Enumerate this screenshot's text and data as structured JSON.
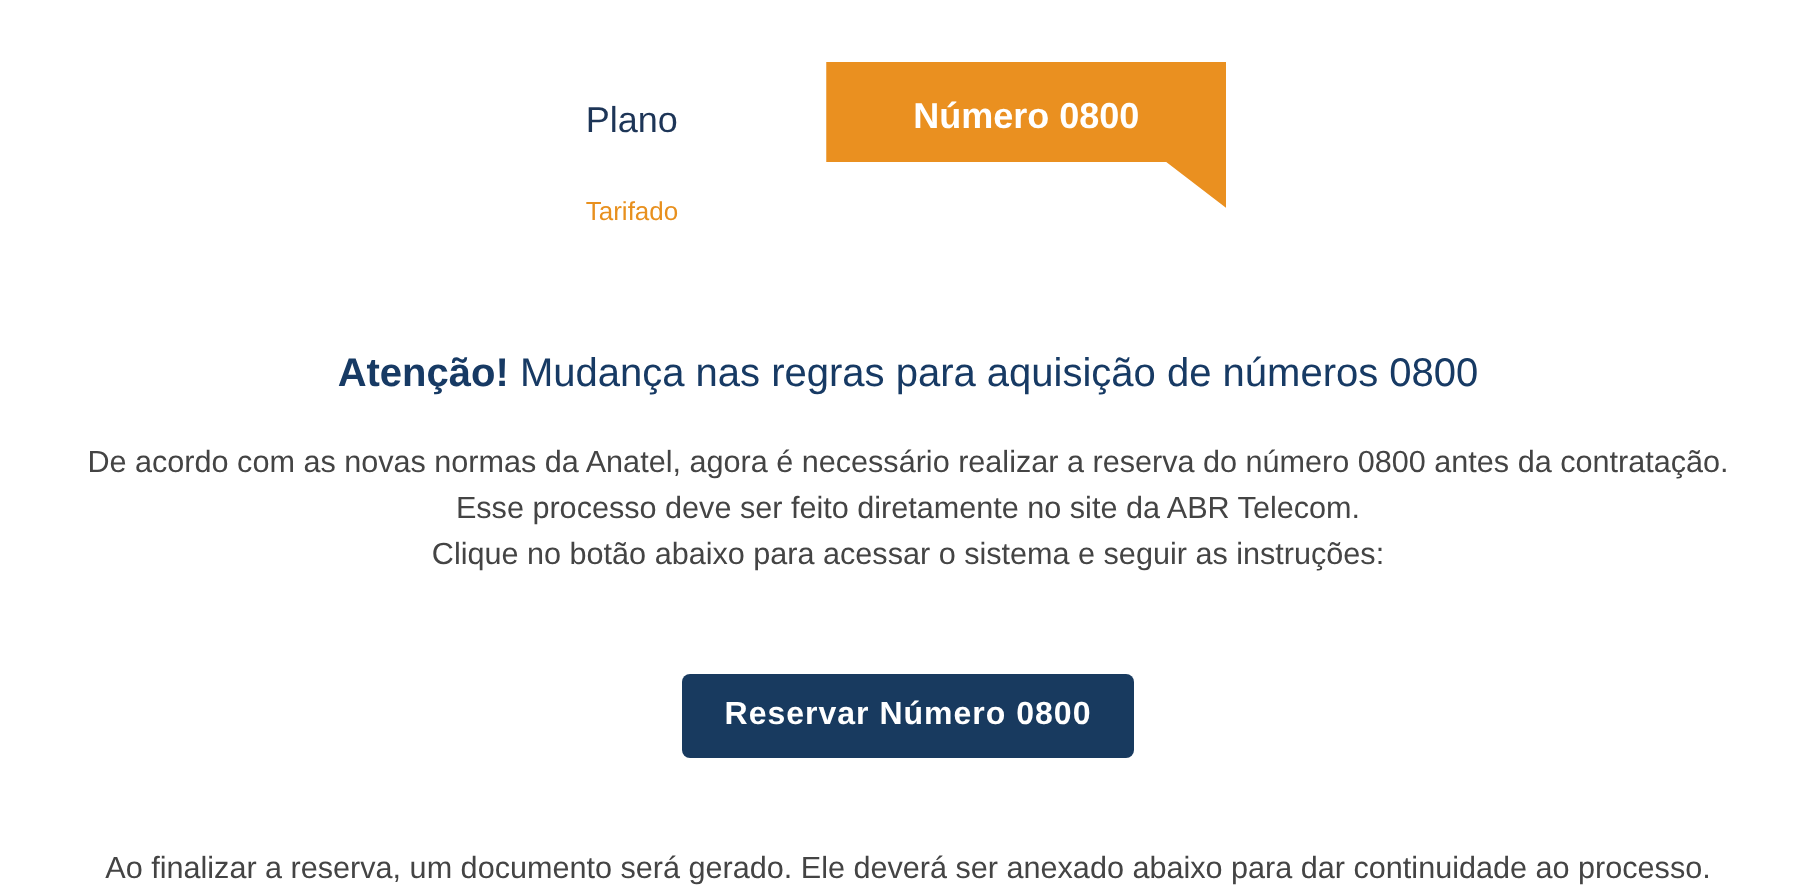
{
  "plan": {
    "label": "Plano",
    "value": "Tarifado",
    "tag": "Número 0800"
  },
  "notice": {
    "title": "**Atenção!** Mudança nas regras para aquisição de números 0800",
    "lines": [
      "De acordo com as novas normas da Anatel, agora é necessário realizar a reserva do número 0800 antes da contratação.",
      "Esse processo deve ser feito diretamente no site da ABR Telecom.",
      "Clique no botão abaixo para acessar o sistema e seguir as instruções:"
    ]
  },
  "button": "Reservar Número 0800",
  "footer_text": "Ao finalizar a reserva, um documento será gerado. Ele deverá ser anexado abaixo para dar continuidade ao processo."
}
